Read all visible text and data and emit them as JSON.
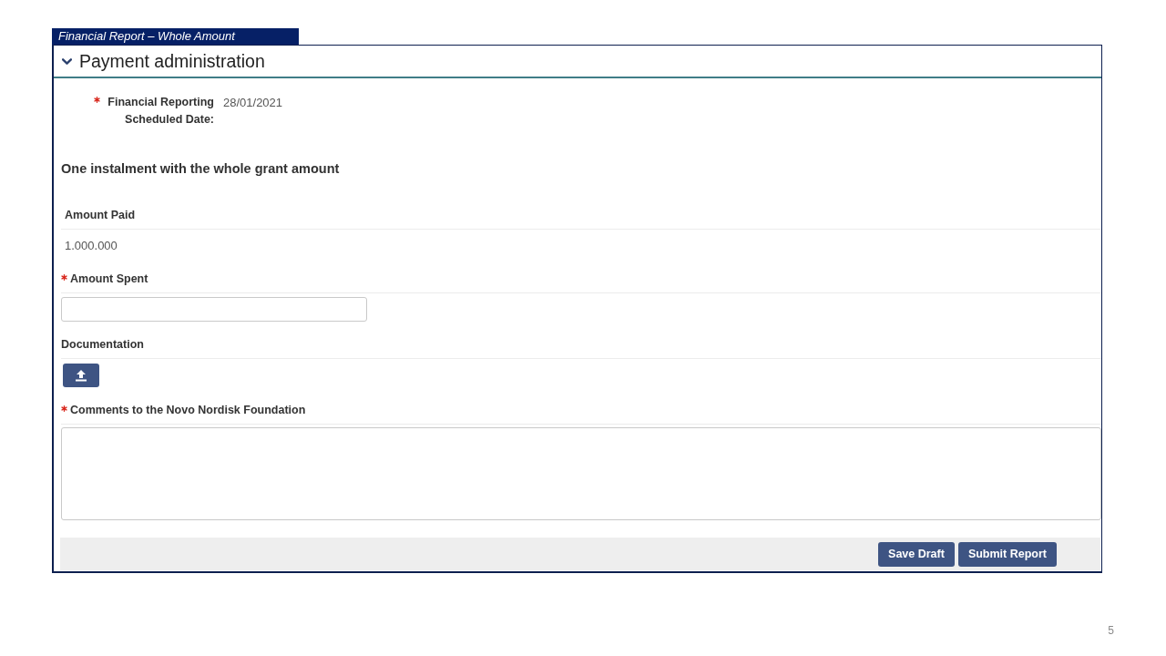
{
  "slide_tag": {
    "title": "Financial Report – Whole Amount"
  },
  "section": {
    "title": "Payment administration",
    "expanded": true,
    "scheduled_date": {
      "label": "Financial Reporting Scheduled Date:",
      "required": true,
      "value": "28/01/2021"
    },
    "heading": "One instalment with the whole grant amount",
    "fields": [
      {
        "kind": "display",
        "label": "Amount Paid",
        "required": false,
        "value": "1.000.000"
      },
      {
        "kind": "input",
        "label": "Amount Spent",
        "required": true
      },
      {
        "kind": "upload",
        "label": "Documentation",
        "required": false
      },
      {
        "kind": "textarea",
        "label": "Comments to the Novo Nordisk Foundation",
        "required": true
      }
    ],
    "footer_buttons": [
      "Save Draft",
      "Submit Report"
    ]
  },
  "page_number": "5"
}
